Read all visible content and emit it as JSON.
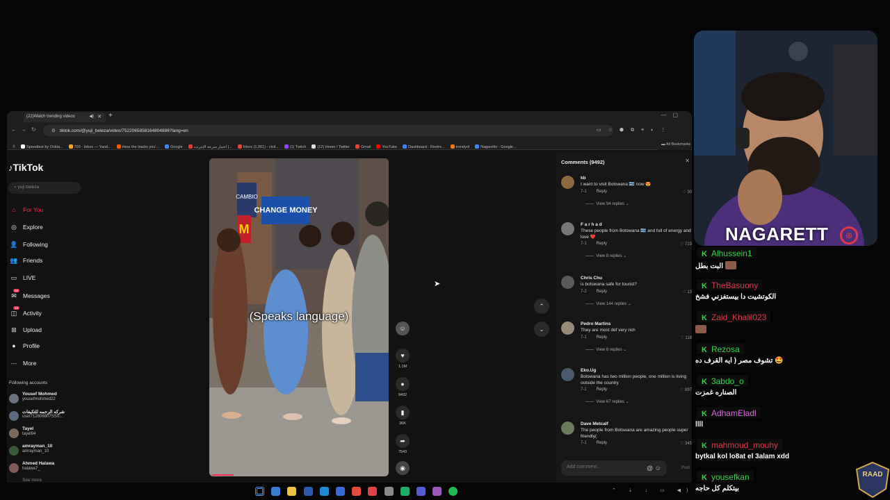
{
  "browser": {
    "tab_title": "(22)Watch trending videos",
    "new_tab": "+",
    "url": "tiktok.com/@yuji_beleza/video/7522065858164804886?lang=en",
    "bookmarks": [
      {
        "label": "Speedtest by Ookla...",
        "color": "#ffffff"
      },
      {
        "label": "703 - Inbox — Yand...",
        "color": "#f5a623"
      },
      {
        "label": "Hear the tracks you'...",
        "color": "#ff5500"
      },
      {
        "label": "Google",
        "color": "#4285f4"
      },
      {
        "label": "اختبار سرعة الإنترنت |...",
        "color": "#e53935"
      },
      {
        "label": "Inbox (1,061) - civil...",
        "color": "#ea4335"
      },
      {
        "label": "(1) Twitch",
        "color": "#9146ff"
      },
      {
        "label": "(12) Home / Twitter",
        "color": "#dddddd"
      },
      {
        "label": "Gmail",
        "color": "#ea4335"
      },
      {
        "label": "YouTube",
        "color": "#ff0000"
      },
      {
        "label": "Dashboard - Restre...",
        "color": "#3b82f6"
      },
      {
        "label": "trendyol",
        "color": "#f27a1a"
      },
      {
        "label": "Nagaretto - Google...",
        "color": "#4285f4"
      }
    ],
    "all_bookmarks": "All Bookmarks"
  },
  "tiktok": {
    "logo": "TikTok",
    "search_placeholder": "yuji beleza",
    "nav": [
      {
        "label": "For You",
        "icon": "home-icon",
        "glyph": "⌂",
        "active": true
      },
      {
        "label": "Explore",
        "icon": "compass-icon",
        "glyph": "◎",
        "active": false
      },
      {
        "label": "Following",
        "icon": "following-icon",
        "glyph": "👤",
        "active": false
      },
      {
        "label": "Friends",
        "icon": "friends-icon",
        "glyph": "👥",
        "active": false
      },
      {
        "label": "LIVE",
        "icon": "live-icon",
        "glyph": "▭",
        "active": false
      },
      {
        "label": "Messages",
        "icon": "messages-icon",
        "glyph": "✉",
        "active": false,
        "badge": "55"
      },
      {
        "label": "Activity",
        "icon": "activity-icon",
        "glyph": "◫",
        "active": false,
        "badge": "18"
      },
      {
        "label": "Upload",
        "icon": "upload-icon",
        "glyph": "⊞",
        "active": false
      },
      {
        "label": "Profile",
        "icon": "profile-icon",
        "glyph": "●",
        "active": false
      },
      {
        "label": "More",
        "icon": "more-icon",
        "glyph": "⋯",
        "active": false
      }
    ],
    "following_header": "Following accounts",
    "following": [
      {
        "name": "Yousef Mohmed",
        "handle": "yousefmohmed22"
      },
      {
        "name": "شركه الرحمه للتكيفات",
        "handle": "user712808807SS0..."
      },
      {
        "name": "Tayel",
        "handle": "tayel94"
      },
      {
        "name": "amrayman_10",
        "handle": "amrayman_10"
      },
      {
        "name": "Ahmed Halawa",
        "handle": "halawa7_"
      }
    ],
    "see_more": "See more",
    "video": {
      "caption": "(Speaks language)",
      "progress": 0.12,
      "signs": [
        "CAMBIO",
        "CHANGE MONEY",
        "M"
      ]
    },
    "actions": {
      "likes": "1.1M",
      "comments": "9492",
      "saves": "36K",
      "shares": "7543"
    },
    "comments": {
      "title": "Comments (9492)",
      "reply_label": "Reply",
      "items": [
        {
          "user": "kb",
          "text": "I want to visit Botswana 🇧🇼 now 😍",
          "date": "7-1",
          "likes": "30",
          "replies": "View 94 replies",
          "avatar": "#8a6a3e"
        },
        {
          "user": "F a r h a d",
          "text": "These people from Botswana 🇧🇼 and full of energy and love ❤️",
          "date": "7-1",
          "likes": "723",
          "replies": "View 8 replies",
          "avatar": "#777777"
        },
        {
          "user": "Chris Chu",
          "text": "is botswana safe for tourist?",
          "date": "7-2",
          "likes": "13",
          "replies": "View 144 replies",
          "avatar": "#5a5a5a"
        },
        {
          "user": "Pedro Martins",
          "text": "They are most def very rich",
          "date": "7-1",
          "likes": "118",
          "replies": "View 6 replies",
          "avatar": "#9a8a7a"
        },
        {
          "user": "Eko.Ug",
          "text": "Botswana has two million people, one million is living outside the country",
          "date": "7-1",
          "likes": "897",
          "replies": "View 67 replies",
          "avatar": "#4a5a6a"
        },
        {
          "user": "Dave Metcalf",
          "text": "The people from Botswana are amazing people super friendly(",
          "date": "7-1",
          "likes": "345",
          "replies": "",
          "avatar": "#6a7a5a"
        }
      ],
      "add_placeholder": "Add comment...",
      "post_label": "Post"
    }
  },
  "stream": {
    "brand": "NAGARETT",
    "chat": [
      {
        "user": "Alhussein1",
        "color": "#35d24a",
        "msg": "البت بطل",
        "emote": true
      },
      {
        "user": "TheBasuony",
        "color": "#e0374d",
        "msg": "الكوتشيت دا بيستفزني فشخ",
        "emote": false
      },
      {
        "user": "Zaid_Khalil023",
        "color": "#e0374d",
        "msg": "",
        "emote": true
      },
      {
        "user": "Rezosa",
        "color": "#35d24a",
        "msg": "تشوف مصر ( ايه القرف ده 🤩",
        "emote": false
      },
      {
        "user": "3abdo_o",
        "color": "#35d24a",
        "msg": "الصناره غمزت",
        "emote": false
      },
      {
        "user": "AdhamEladl",
        "color": "#d66ad6",
        "msg": "اااا",
        "emote": false
      },
      {
        "user": "mahmoud_mouhy",
        "color": "#e0374d",
        "msg": "bytkal kol lo8at el 3alam xdd",
        "emote": false
      },
      {
        "user": "yousefkan",
        "color": "#35d24a",
        "msg": "بيتكلم كل حاجه",
        "emote": false
      }
    ],
    "badge_text": "RAAD"
  }
}
